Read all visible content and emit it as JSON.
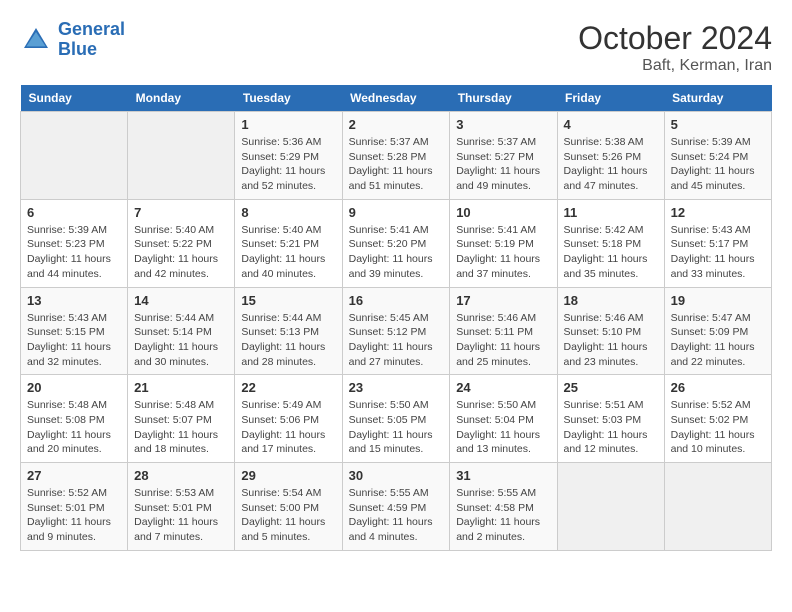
{
  "header": {
    "logo_line1": "General",
    "logo_line2": "Blue",
    "month": "October 2024",
    "location": "Baft, Kerman, Iran"
  },
  "weekdays": [
    "Sunday",
    "Monday",
    "Tuesday",
    "Wednesday",
    "Thursday",
    "Friday",
    "Saturday"
  ],
  "weeks": [
    [
      {
        "day": "",
        "info": ""
      },
      {
        "day": "",
        "info": ""
      },
      {
        "day": "1",
        "info": "Sunrise: 5:36 AM\nSunset: 5:29 PM\nDaylight: 11 hours and 52 minutes."
      },
      {
        "day": "2",
        "info": "Sunrise: 5:37 AM\nSunset: 5:28 PM\nDaylight: 11 hours and 51 minutes."
      },
      {
        "day": "3",
        "info": "Sunrise: 5:37 AM\nSunset: 5:27 PM\nDaylight: 11 hours and 49 minutes."
      },
      {
        "day": "4",
        "info": "Sunrise: 5:38 AM\nSunset: 5:26 PM\nDaylight: 11 hours and 47 minutes."
      },
      {
        "day": "5",
        "info": "Sunrise: 5:39 AM\nSunset: 5:24 PM\nDaylight: 11 hours and 45 minutes."
      }
    ],
    [
      {
        "day": "6",
        "info": "Sunrise: 5:39 AM\nSunset: 5:23 PM\nDaylight: 11 hours and 44 minutes."
      },
      {
        "day": "7",
        "info": "Sunrise: 5:40 AM\nSunset: 5:22 PM\nDaylight: 11 hours and 42 minutes."
      },
      {
        "day": "8",
        "info": "Sunrise: 5:40 AM\nSunset: 5:21 PM\nDaylight: 11 hours and 40 minutes."
      },
      {
        "day": "9",
        "info": "Sunrise: 5:41 AM\nSunset: 5:20 PM\nDaylight: 11 hours and 39 minutes."
      },
      {
        "day": "10",
        "info": "Sunrise: 5:41 AM\nSunset: 5:19 PM\nDaylight: 11 hours and 37 minutes."
      },
      {
        "day": "11",
        "info": "Sunrise: 5:42 AM\nSunset: 5:18 PM\nDaylight: 11 hours and 35 minutes."
      },
      {
        "day": "12",
        "info": "Sunrise: 5:43 AM\nSunset: 5:17 PM\nDaylight: 11 hours and 33 minutes."
      }
    ],
    [
      {
        "day": "13",
        "info": "Sunrise: 5:43 AM\nSunset: 5:15 PM\nDaylight: 11 hours and 32 minutes."
      },
      {
        "day": "14",
        "info": "Sunrise: 5:44 AM\nSunset: 5:14 PM\nDaylight: 11 hours and 30 minutes."
      },
      {
        "day": "15",
        "info": "Sunrise: 5:44 AM\nSunset: 5:13 PM\nDaylight: 11 hours and 28 minutes."
      },
      {
        "day": "16",
        "info": "Sunrise: 5:45 AM\nSunset: 5:12 PM\nDaylight: 11 hours and 27 minutes."
      },
      {
        "day": "17",
        "info": "Sunrise: 5:46 AM\nSunset: 5:11 PM\nDaylight: 11 hours and 25 minutes."
      },
      {
        "day": "18",
        "info": "Sunrise: 5:46 AM\nSunset: 5:10 PM\nDaylight: 11 hours and 23 minutes."
      },
      {
        "day": "19",
        "info": "Sunrise: 5:47 AM\nSunset: 5:09 PM\nDaylight: 11 hours and 22 minutes."
      }
    ],
    [
      {
        "day": "20",
        "info": "Sunrise: 5:48 AM\nSunset: 5:08 PM\nDaylight: 11 hours and 20 minutes."
      },
      {
        "day": "21",
        "info": "Sunrise: 5:48 AM\nSunset: 5:07 PM\nDaylight: 11 hours and 18 minutes."
      },
      {
        "day": "22",
        "info": "Sunrise: 5:49 AM\nSunset: 5:06 PM\nDaylight: 11 hours and 17 minutes."
      },
      {
        "day": "23",
        "info": "Sunrise: 5:50 AM\nSunset: 5:05 PM\nDaylight: 11 hours and 15 minutes."
      },
      {
        "day": "24",
        "info": "Sunrise: 5:50 AM\nSunset: 5:04 PM\nDaylight: 11 hours and 13 minutes."
      },
      {
        "day": "25",
        "info": "Sunrise: 5:51 AM\nSunset: 5:03 PM\nDaylight: 11 hours and 12 minutes."
      },
      {
        "day": "26",
        "info": "Sunrise: 5:52 AM\nSunset: 5:02 PM\nDaylight: 11 hours and 10 minutes."
      }
    ],
    [
      {
        "day": "27",
        "info": "Sunrise: 5:52 AM\nSunset: 5:01 PM\nDaylight: 11 hours and 9 minutes."
      },
      {
        "day": "28",
        "info": "Sunrise: 5:53 AM\nSunset: 5:01 PM\nDaylight: 11 hours and 7 minutes."
      },
      {
        "day": "29",
        "info": "Sunrise: 5:54 AM\nSunset: 5:00 PM\nDaylight: 11 hours and 5 minutes."
      },
      {
        "day": "30",
        "info": "Sunrise: 5:55 AM\nSunset: 4:59 PM\nDaylight: 11 hours and 4 minutes."
      },
      {
        "day": "31",
        "info": "Sunrise: 5:55 AM\nSunset: 4:58 PM\nDaylight: 11 hours and 2 minutes."
      },
      {
        "day": "",
        "info": ""
      },
      {
        "day": "",
        "info": ""
      }
    ]
  ]
}
